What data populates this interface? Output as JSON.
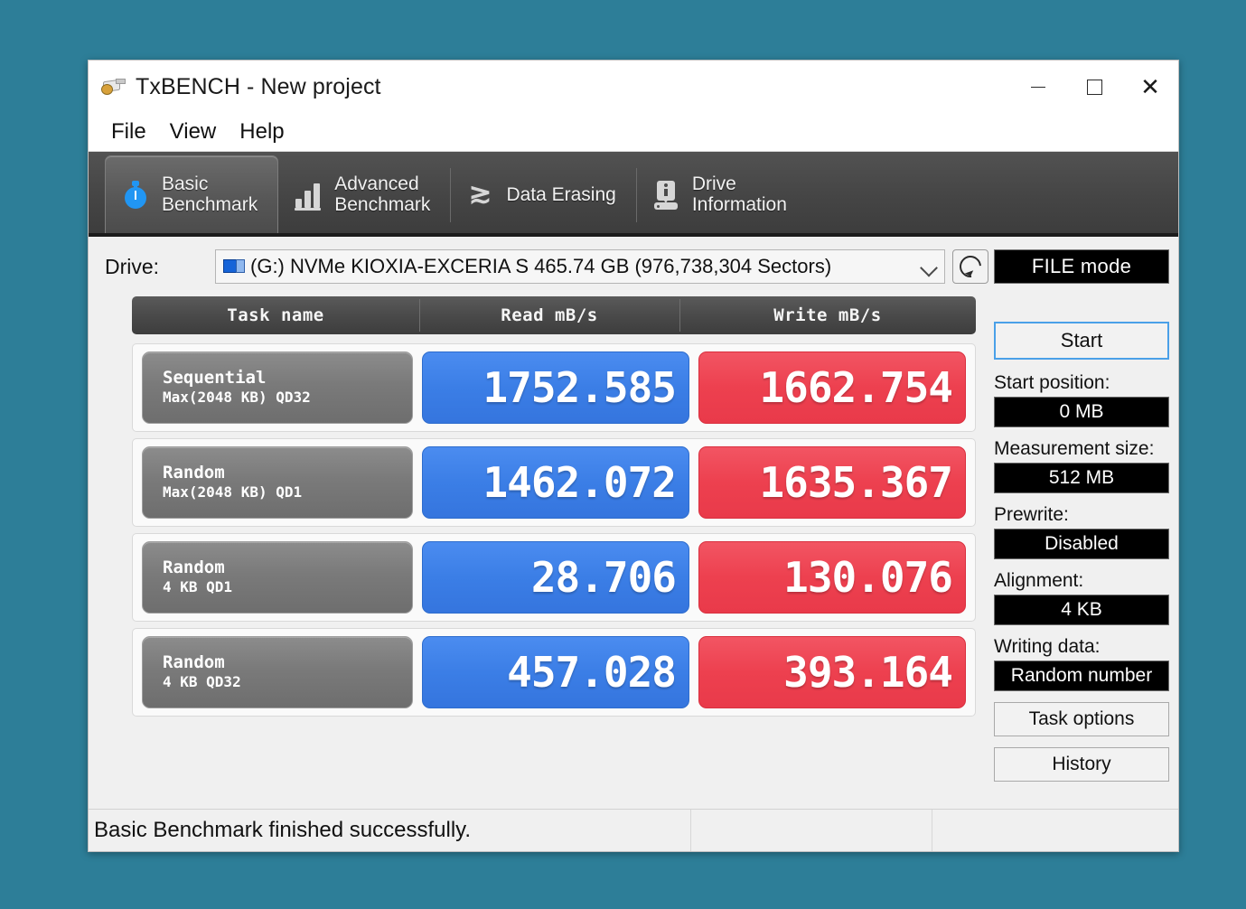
{
  "window": {
    "title": "TxBENCH - New project",
    "app_icon": "plug-icon",
    "controls": {
      "minimize": "minimize-icon",
      "maximize": "maximize-icon",
      "close": "close-icon"
    }
  },
  "menubar": {
    "items": [
      {
        "label": "File"
      },
      {
        "label": "View"
      },
      {
        "label": "Help"
      }
    ]
  },
  "tabs": [
    {
      "label": "Basic\nBenchmark",
      "icon": "stopwatch-icon",
      "active": true
    },
    {
      "label": "Advanced\nBenchmark",
      "icon": "bar-chart-icon",
      "active": false
    },
    {
      "label": "Data Erasing",
      "icon": "eraser-wave-icon",
      "active": false
    },
    {
      "label": "Drive\nInformation",
      "icon": "drive-info-icon",
      "active": false
    }
  ],
  "drive": {
    "label": "Drive:",
    "icon": "drive-icon",
    "selected": "(G:) NVMe KIOXIA-EXCERIA S  465.74 GB (976,738,304 Sectors)",
    "dropdown_icon": "chevron-down-icon",
    "refresh_icon": "refresh-icon"
  },
  "benchmark": {
    "headers": {
      "task": "Task name",
      "read": "Read mB/s",
      "write": "Write mB/s"
    },
    "rows": [
      {
        "task_line1": "Sequential",
        "task_line2": "Max(2048 KB) QD32",
        "read": "1752.585",
        "write": "1662.754"
      },
      {
        "task_line1": "Random",
        "task_line2": "Max(2048 KB) QD1",
        "read": "1462.072",
        "write": "1635.367"
      },
      {
        "task_line1": "Random",
        "task_line2": "4 KB QD1",
        "read": "28.706",
        "write": "130.076"
      },
      {
        "task_line1": "Random",
        "task_line2": "4 KB QD32",
        "read": "457.028",
        "write": "393.164"
      }
    ]
  },
  "sidebar": {
    "mode": "FILE mode",
    "start_button": "Start",
    "fields": [
      {
        "label": "Start position:",
        "value": "0 MB"
      },
      {
        "label": "Measurement size:",
        "value": "512 MB"
      },
      {
        "label": "Prewrite:",
        "value": "Disabled"
      },
      {
        "label": "Alignment:",
        "value": "4 KB"
      },
      {
        "label": "Writing data:",
        "value": "Random number"
      }
    ],
    "task_options_button": "Task options",
    "history_button": "History"
  },
  "statusbar": {
    "message": "Basic Benchmark finished successfully.",
    "pane2": "",
    "pane3": ""
  },
  "colors": {
    "desktop_background": "#2d7e98",
    "read_panel": "#3b7ee6",
    "write_panel": "#ed404f",
    "task_panel": "#7a7a7a",
    "accent_focus": "#4aa0e8",
    "tabstrip": "#4a4a4a"
  }
}
